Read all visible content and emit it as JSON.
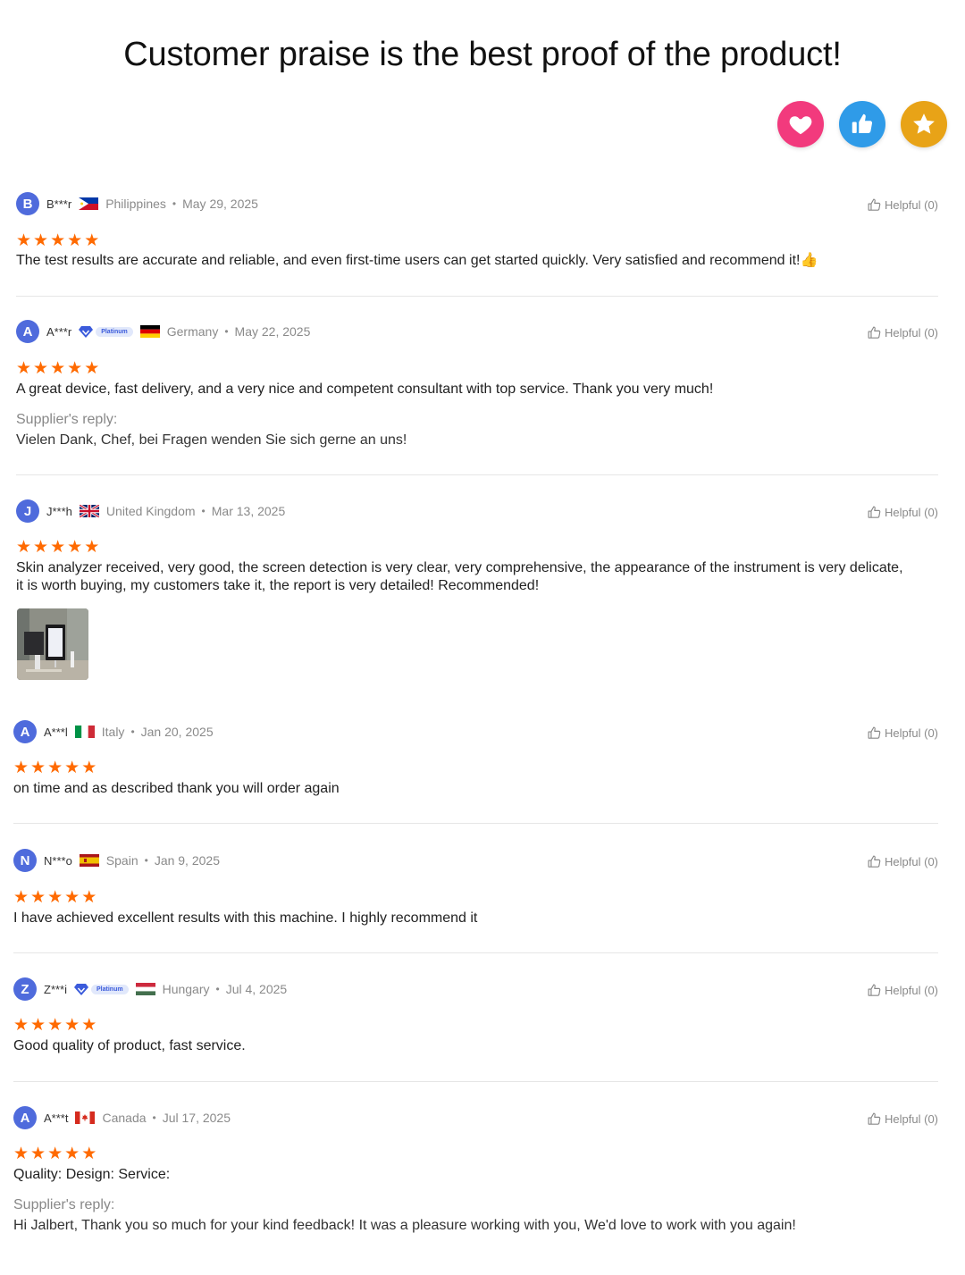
{
  "headline": "Customer praise is the best proof of the product!",
  "badges": [
    {
      "icon": "heart-icon",
      "color": "#f23a7d"
    },
    {
      "icon": "thumbs-up-icon",
      "color": "#2f9be8"
    },
    {
      "icon": "star-icon",
      "color": "#e8a317"
    }
  ],
  "helpful_label": "Helpful (0)",
  "supplier_reply_label": "Supplier's reply:",
  "platinum_label": "Platinum",
  "rating_color": "#ff6a00",
  "reviews": [
    {
      "initial": "B",
      "user": "B***r",
      "country": "Philippines",
      "flag": "ph-flag-icon",
      "date": "May 29, 2025",
      "stars": 5,
      "text": "The test results are accurate and reliable, and even first-time users can get started quickly. Very satisfied and recommend it!👍"
    },
    {
      "initial": "A",
      "user": "A***r",
      "platinum": true,
      "country": "Germany",
      "flag": "de-flag-icon",
      "date": "May 22, 2025",
      "stars": 5,
      "text": "A great device, fast delivery, and a very nice and competent consultant with top service. Thank you very much!",
      "reply": "Vielen Dank, Chef, bei Fragen wenden Sie sich gerne an uns!"
    },
    {
      "initial": "J",
      "user": "J***h",
      "country": "United Kingdom",
      "flag": "uk-flag-icon",
      "date": "Mar 13, 2025",
      "stars": 5,
      "text": "Skin analyzer received, very good, the screen detection is very clear, very comprehensive, the appearance of the instrument is very delicate, it is worth buying, my customers take it, the report is very detailed! Recommended!"
    },
    {
      "initial": "A",
      "user": "A***l",
      "country": "Italy",
      "flag": "it-flag-icon",
      "date": "Jan 20, 2025",
      "stars": 5,
      "text": "on time and as described thank you will order again"
    },
    {
      "initial": "N",
      "user": "N***o",
      "country": "Spain",
      "flag": "es-flag-icon",
      "date": "Jan 9, 2025",
      "stars": 5,
      "text": "I have achieved excellent results with this machine. I highly recommend it"
    },
    {
      "initial": "Z",
      "user": "Z***i",
      "platinum": true,
      "country": "Hungary",
      "flag": "hu-flag-icon",
      "date": "Jul 4, 2025",
      "stars": 5,
      "text": "Good quality of product, fast service."
    },
    {
      "initial": "A",
      "user": "A***t",
      "country": "Canada",
      "flag": "ca-flag-icon",
      "date": "Jul 17, 2025",
      "stars": 5,
      "text": "Quality: Design: Service:",
      "reply": "Hi Jalbert, Thank you so much for your kind feedback! It was a pleasure working with you, We'd love to work with you again!"
    }
  ]
}
